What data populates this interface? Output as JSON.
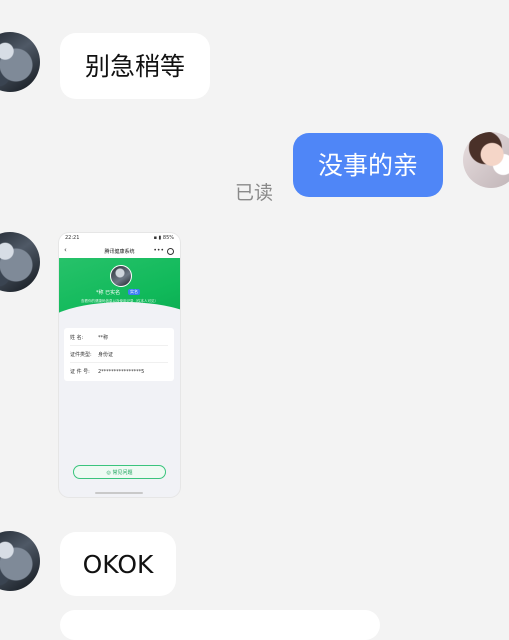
{
  "messages": [
    {
      "text": "别急稍等"
    },
    {
      "text": "没事的亲",
      "status": "已读"
    },
    {
      "text": "OKOK"
    }
  ],
  "screenshot": {
    "status_time": "22:21",
    "status_right": "▪ ▮ 85%",
    "title": "腾讯健康系统",
    "name": "*称    已实名",
    "tag": "实名",
    "tip": "查看你的健康码信息以及使用记录（仅本人可见）",
    "rows": [
      {
        "k": "姓    名:",
        "v": "**称"
      },
      {
        "k": "证件类型:",
        "v": "身份证"
      },
      {
        "k": "证 件 号:",
        "v": "2****************5"
      }
    ],
    "help": "◎ 常见问题"
  },
  "colors": {
    "outgoing_bubble": "#4f86f7",
    "app_green": "#10b95a"
  }
}
